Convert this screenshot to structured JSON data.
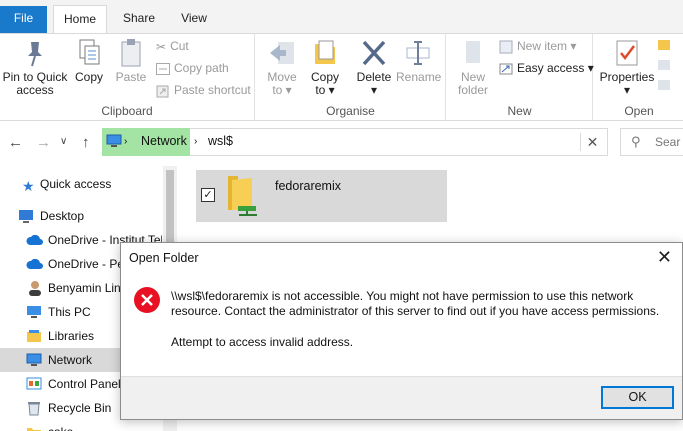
{
  "tabs": [
    {
      "label": "File"
    },
    {
      "label": "Home"
    },
    {
      "label": "Share"
    },
    {
      "label": "View"
    }
  ],
  "ribbon": {
    "clipboard": {
      "label": "Clipboard",
      "pin": "Pin to Quick access",
      "copy": "Copy",
      "paste": "Paste",
      "cut": "Cut",
      "copy_path": "Copy path",
      "paste_shortcut": "Paste shortcut"
    },
    "organise": {
      "label": "Organise",
      "move_to": "Move to",
      "copy_to": "Copy to",
      "delete": "Delete",
      "rename": "Rename"
    },
    "new": {
      "label": "New",
      "new_folder": "New folder",
      "new_item": "New item",
      "easy_access": "Easy access"
    },
    "open": {
      "label": "Open",
      "properties": "Properties"
    }
  },
  "address": {
    "crumbs": [
      "Network",
      "wsl$"
    ],
    "search_placeholder": "Sear"
  },
  "nav": [
    {
      "label": "Quick access",
      "icon": "star-icon"
    },
    {
      "label": "Desktop",
      "icon": "desktop-icon"
    },
    {
      "label": "OneDrive - Institut Tel",
      "icon": "cloud-icon"
    },
    {
      "label": "OneDrive - Pe",
      "icon": "cloud-icon"
    },
    {
      "label": "Benyamin Lin",
      "icon": "user-icon"
    },
    {
      "label": "This PC",
      "icon": "pc-icon"
    },
    {
      "label": "Libraries",
      "icon": "library-icon"
    },
    {
      "label": "Network",
      "icon": "network-icon"
    },
    {
      "label": "Control Panel",
      "icon": "control-panel-icon"
    },
    {
      "label": "Recycle Bin",
      "icon": "recycle-bin-icon"
    },
    {
      "label": "cake",
      "icon": "folder-icon"
    }
  ],
  "content": {
    "items": [
      {
        "name": "fedoraremix",
        "checked": "✓"
      }
    ]
  },
  "dialog": {
    "title": "Open Folder",
    "message": "\\\\wsl$\\fedoraremix is not accessible. You might not have permission to use this network resource. Contact the administrator of this server to find out if you have access permissions.",
    "detail": "Attempt to access invalid address.",
    "ok_label": "OK"
  },
  "colors": {
    "file_tab": "#1979ca",
    "address_highlight": "#a3e3a3",
    "error_red": "#e81123",
    "ok_border": "#0078d7"
  }
}
